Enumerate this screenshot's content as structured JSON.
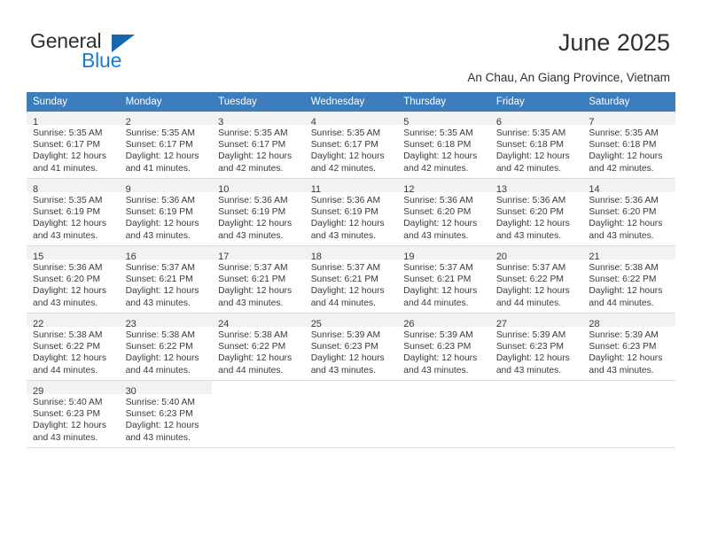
{
  "brand": {
    "name_top": "General",
    "name_bottom": "Blue",
    "triangle_color": "#1468b0",
    "blue_text_color": "#1a7cd1"
  },
  "header": {
    "title": "June 2025",
    "subtitle": "An Chau, An Giang Province, Vietnam"
  },
  "theme": {
    "header_bg": "#3b7dbd",
    "header_text": "#ffffff",
    "daynum_band_bg": "#f2f2f2",
    "grid_line": "#dddddd",
    "body_text": "#3a3a3a"
  },
  "weekday_headers": [
    "Sunday",
    "Monday",
    "Tuesday",
    "Wednesday",
    "Thursday",
    "Friday",
    "Saturday"
  ],
  "labels": {
    "sunrise_prefix": "Sunrise:",
    "sunset_prefix": "Sunset:",
    "daylight_prefix": "Daylight:"
  },
  "weeks": [
    [
      {
        "day": "1",
        "sunrise": "Sunrise: 5:35 AM",
        "sunset": "Sunset: 6:17 PM",
        "daylight_line1": "Daylight: 12 hours",
        "daylight_line2": "and 41 minutes."
      },
      {
        "day": "2",
        "sunrise": "Sunrise: 5:35 AM",
        "sunset": "Sunset: 6:17 PM",
        "daylight_line1": "Daylight: 12 hours",
        "daylight_line2": "and 41 minutes."
      },
      {
        "day": "3",
        "sunrise": "Sunrise: 5:35 AM",
        "sunset": "Sunset: 6:17 PM",
        "daylight_line1": "Daylight: 12 hours",
        "daylight_line2": "and 42 minutes."
      },
      {
        "day": "4",
        "sunrise": "Sunrise: 5:35 AM",
        "sunset": "Sunset: 6:17 PM",
        "daylight_line1": "Daylight: 12 hours",
        "daylight_line2": "and 42 minutes."
      },
      {
        "day": "5",
        "sunrise": "Sunrise: 5:35 AM",
        "sunset": "Sunset: 6:18 PM",
        "daylight_line1": "Daylight: 12 hours",
        "daylight_line2": "and 42 minutes."
      },
      {
        "day": "6",
        "sunrise": "Sunrise: 5:35 AM",
        "sunset": "Sunset: 6:18 PM",
        "daylight_line1": "Daylight: 12 hours",
        "daylight_line2": "and 42 minutes."
      },
      {
        "day": "7",
        "sunrise": "Sunrise: 5:35 AM",
        "sunset": "Sunset: 6:18 PM",
        "daylight_line1": "Daylight: 12 hours",
        "daylight_line2": "and 42 minutes."
      }
    ],
    [
      {
        "day": "8",
        "sunrise": "Sunrise: 5:35 AM",
        "sunset": "Sunset: 6:19 PM",
        "daylight_line1": "Daylight: 12 hours",
        "daylight_line2": "and 43 minutes."
      },
      {
        "day": "9",
        "sunrise": "Sunrise: 5:36 AM",
        "sunset": "Sunset: 6:19 PM",
        "daylight_line1": "Daylight: 12 hours",
        "daylight_line2": "and 43 minutes."
      },
      {
        "day": "10",
        "sunrise": "Sunrise: 5:36 AM",
        "sunset": "Sunset: 6:19 PM",
        "daylight_line1": "Daylight: 12 hours",
        "daylight_line2": "and 43 minutes."
      },
      {
        "day": "11",
        "sunrise": "Sunrise: 5:36 AM",
        "sunset": "Sunset: 6:19 PM",
        "daylight_line1": "Daylight: 12 hours",
        "daylight_line2": "and 43 minutes."
      },
      {
        "day": "12",
        "sunrise": "Sunrise: 5:36 AM",
        "sunset": "Sunset: 6:20 PM",
        "daylight_line1": "Daylight: 12 hours",
        "daylight_line2": "and 43 minutes."
      },
      {
        "day": "13",
        "sunrise": "Sunrise: 5:36 AM",
        "sunset": "Sunset: 6:20 PM",
        "daylight_line1": "Daylight: 12 hours",
        "daylight_line2": "and 43 minutes."
      },
      {
        "day": "14",
        "sunrise": "Sunrise: 5:36 AM",
        "sunset": "Sunset: 6:20 PM",
        "daylight_line1": "Daylight: 12 hours",
        "daylight_line2": "and 43 minutes."
      }
    ],
    [
      {
        "day": "15",
        "sunrise": "Sunrise: 5:36 AM",
        "sunset": "Sunset: 6:20 PM",
        "daylight_line1": "Daylight: 12 hours",
        "daylight_line2": "and 43 minutes."
      },
      {
        "day": "16",
        "sunrise": "Sunrise: 5:37 AM",
        "sunset": "Sunset: 6:21 PM",
        "daylight_line1": "Daylight: 12 hours",
        "daylight_line2": "and 43 minutes."
      },
      {
        "day": "17",
        "sunrise": "Sunrise: 5:37 AM",
        "sunset": "Sunset: 6:21 PM",
        "daylight_line1": "Daylight: 12 hours",
        "daylight_line2": "and 43 minutes."
      },
      {
        "day": "18",
        "sunrise": "Sunrise: 5:37 AM",
        "sunset": "Sunset: 6:21 PM",
        "daylight_line1": "Daylight: 12 hours",
        "daylight_line2": "and 44 minutes."
      },
      {
        "day": "19",
        "sunrise": "Sunrise: 5:37 AM",
        "sunset": "Sunset: 6:21 PM",
        "daylight_line1": "Daylight: 12 hours",
        "daylight_line2": "and 44 minutes."
      },
      {
        "day": "20",
        "sunrise": "Sunrise: 5:37 AM",
        "sunset": "Sunset: 6:22 PM",
        "daylight_line1": "Daylight: 12 hours",
        "daylight_line2": "and 44 minutes."
      },
      {
        "day": "21",
        "sunrise": "Sunrise: 5:38 AM",
        "sunset": "Sunset: 6:22 PM",
        "daylight_line1": "Daylight: 12 hours",
        "daylight_line2": "and 44 minutes."
      }
    ],
    [
      {
        "day": "22",
        "sunrise": "Sunrise: 5:38 AM",
        "sunset": "Sunset: 6:22 PM",
        "daylight_line1": "Daylight: 12 hours",
        "daylight_line2": "and 44 minutes."
      },
      {
        "day": "23",
        "sunrise": "Sunrise: 5:38 AM",
        "sunset": "Sunset: 6:22 PM",
        "daylight_line1": "Daylight: 12 hours",
        "daylight_line2": "and 44 minutes."
      },
      {
        "day": "24",
        "sunrise": "Sunrise: 5:38 AM",
        "sunset": "Sunset: 6:22 PM",
        "daylight_line1": "Daylight: 12 hours",
        "daylight_line2": "and 44 minutes."
      },
      {
        "day": "25",
        "sunrise": "Sunrise: 5:39 AM",
        "sunset": "Sunset: 6:23 PM",
        "daylight_line1": "Daylight: 12 hours",
        "daylight_line2": "and 43 minutes."
      },
      {
        "day": "26",
        "sunrise": "Sunrise: 5:39 AM",
        "sunset": "Sunset: 6:23 PM",
        "daylight_line1": "Daylight: 12 hours",
        "daylight_line2": "and 43 minutes."
      },
      {
        "day": "27",
        "sunrise": "Sunrise: 5:39 AM",
        "sunset": "Sunset: 6:23 PM",
        "daylight_line1": "Daylight: 12 hours",
        "daylight_line2": "and 43 minutes."
      },
      {
        "day": "28",
        "sunrise": "Sunrise: 5:39 AM",
        "sunset": "Sunset: 6:23 PM",
        "daylight_line1": "Daylight: 12 hours",
        "daylight_line2": "and 43 minutes."
      }
    ],
    [
      {
        "day": "29",
        "sunrise": "Sunrise: 5:40 AM",
        "sunset": "Sunset: 6:23 PM",
        "daylight_line1": "Daylight: 12 hours",
        "daylight_line2": "and 43 minutes."
      },
      {
        "day": "30",
        "sunrise": "Sunrise: 5:40 AM",
        "sunset": "Sunset: 6:23 PM",
        "daylight_line1": "Daylight: 12 hours",
        "daylight_line2": "and 43 minutes."
      },
      {
        "day": "",
        "sunrise": "",
        "sunset": "",
        "daylight_line1": "",
        "daylight_line2": ""
      },
      {
        "day": "",
        "sunrise": "",
        "sunset": "",
        "daylight_line1": "",
        "daylight_line2": ""
      },
      {
        "day": "",
        "sunrise": "",
        "sunset": "",
        "daylight_line1": "",
        "daylight_line2": ""
      },
      {
        "day": "",
        "sunrise": "",
        "sunset": "",
        "daylight_line1": "",
        "daylight_line2": ""
      },
      {
        "day": "",
        "sunrise": "",
        "sunset": "",
        "daylight_line1": "",
        "daylight_line2": ""
      }
    ]
  ]
}
